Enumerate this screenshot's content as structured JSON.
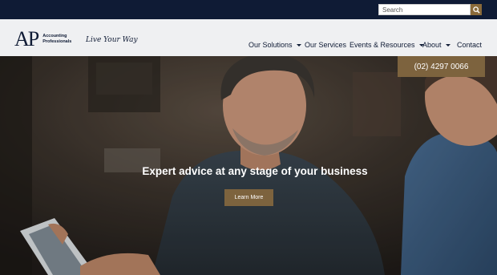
{
  "search": {
    "placeholder": "Search",
    "icon": "search-icon"
  },
  "logo": {
    "mark_a": "A",
    "mark_p": "P",
    "line1": "Accounting",
    "line2": "Professionals",
    "tagline": "Live Your Way"
  },
  "nav": {
    "items": [
      {
        "label": "Our Solutions",
        "has_dropdown": true
      },
      {
        "label": "Our Services",
        "has_dropdown": false
      },
      {
        "label": "Events & Resources",
        "has_dropdown": true
      },
      {
        "label": "About",
        "has_dropdown": true
      },
      {
        "label": "Contact",
        "has_dropdown": false
      }
    ]
  },
  "phone": "(02) 4297 0066",
  "hero": {
    "heading": "Expert advice at any stage of your business",
    "cta": "Learn More"
  },
  "colors": {
    "navy": "#0f1b35",
    "gold": "#7d633e",
    "header_bg": "#eff0f2"
  }
}
